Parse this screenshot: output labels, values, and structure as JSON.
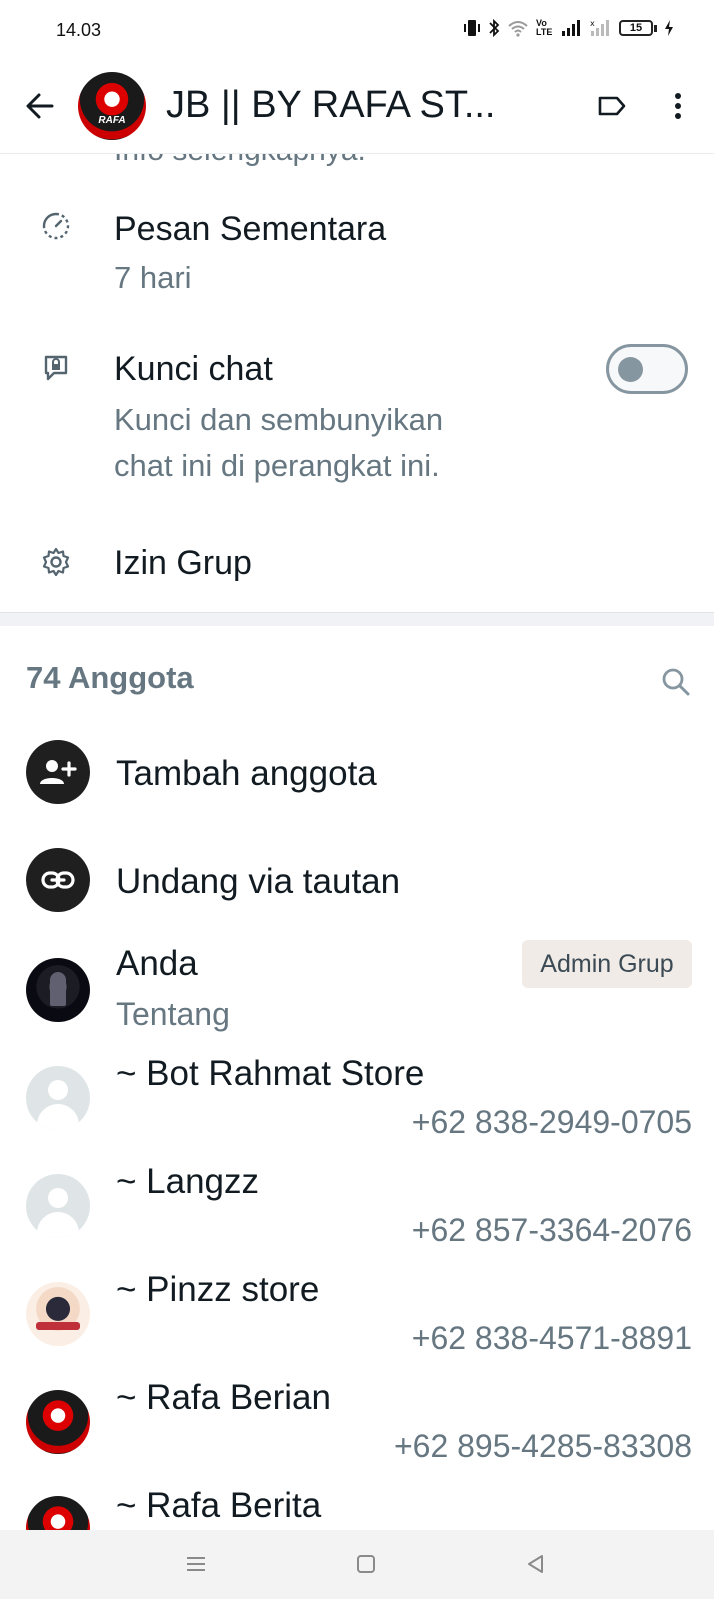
{
  "status_bar": {
    "time": "14.03",
    "volte_label": "Vo LTE",
    "battery_level": "15"
  },
  "header": {
    "title": "JB ||  BY RAFA ST...",
    "avatar_text": "RAFA"
  },
  "info_rows": {
    "cutoff_text": "Info selengkapnya.",
    "disappearing": {
      "title": "Pesan Sementara",
      "subtitle": "7 hari"
    },
    "chat_lock": {
      "title": "Kunci chat",
      "subtitle_line1": "Kunci dan sembunyikan",
      "subtitle_line2": "chat ini di perangkat ini.",
      "enabled": false
    },
    "permissions": {
      "title": "Izin Grup"
    }
  },
  "members": {
    "count_label": "74 Anggota",
    "add_label": "Tambah anggota",
    "invite_label": "Undang via tautan",
    "list": [
      {
        "name": "Anda",
        "subtitle": "Tentang",
        "badge": "Admin Grup"
      },
      {
        "name": "~ Bot Rahmat Store",
        "phone": "+62 838-2949-0705"
      },
      {
        "name": "~ Langzz",
        "phone": "+62 857-3364-2076"
      },
      {
        "name": "~ Pinzz store",
        "phone": "+62 838-4571-8891"
      },
      {
        "name": "~ Rafa Berian",
        "phone": "+62 895-4285-83308"
      },
      {
        "name": "~ Rafa Berita"
      }
    ]
  },
  "colors": {
    "text_primary": "#111b21",
    "text_secondary": "#667781",
    "action_icon_bg": "#1f1f1f",
    "badge_bg": "#f0ebe6"
  },
  "icons": {
    "back": "arrow-left-icon",
    "label": "label-tag-icon",
    "more": "more-vert-icon",
    "disappearing": "timer-icon",
    "chat_lock": "chat-lock-icon",
    "permissions": "gear-icon",
    "search": "search-icon",
    "add_member": "person-add-icon",
    "invite": "link-icon"
  }
}
